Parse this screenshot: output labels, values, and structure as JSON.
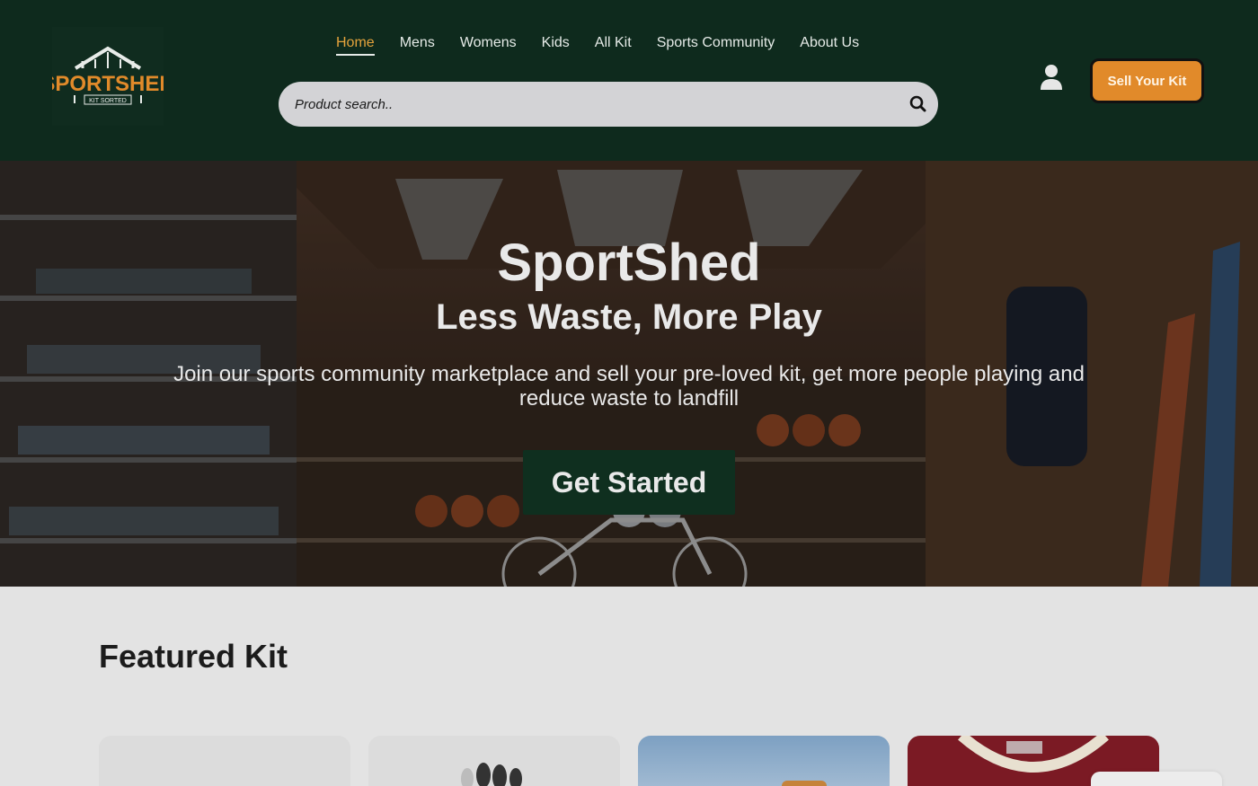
{
  "header": {
    "logo": {
      "wordmark": "SPORTSHED",
      "tagline": "KIT SORTED"
    },
    "nav": [
      {
        "label": "Home",
        "active": true
      },
      {
        "label": "Mens",
        "active": false
      },
      {
        "label": "Womens",
        "active": false
      },
      {
        "label": "Kids",
        "active": false
      },
      {
        "label": "All Kit",
        "active": false
      },
      {
        "label": "Sports Community",
        "active": false
      },
      {
        "label": "About Us",
        "active": false
      }
    ],
    "search": {
      "placeholder": "Product search..",
      "value": "",
      "icon": "search-icon"
    },
    "account_icon": "user-icon",
    "sell_button": "Sell Your Kit"
  },
  "hero": {
    "title": "SportShed",
    "subtitle": "Less Waste, More Play",
    "description": "Join our sports community marketplace and sell your pre-loved kit, get more people playing and reduce waste to landfill",
    "cta": "Get Started"
  },
  "featured": {
    "heading": "Featured Kit",
    "cards": [
      {
        "image": "blank-card"
      },
      {
        "image": "gloves"
      },
      {
        "image": "outdoor-sky"
      },
      {
        "image": "red-jersey"
      }
    ]
  },
  "colors": {
    "header_bg": "#0e2a1d",
    "accent_orange": "#e18a2a",
    "active_nav": "#e4a33c",
    "cta_bg": "#0f2f1f",
    "page_bg": "#e3e3e3"
  }
}
